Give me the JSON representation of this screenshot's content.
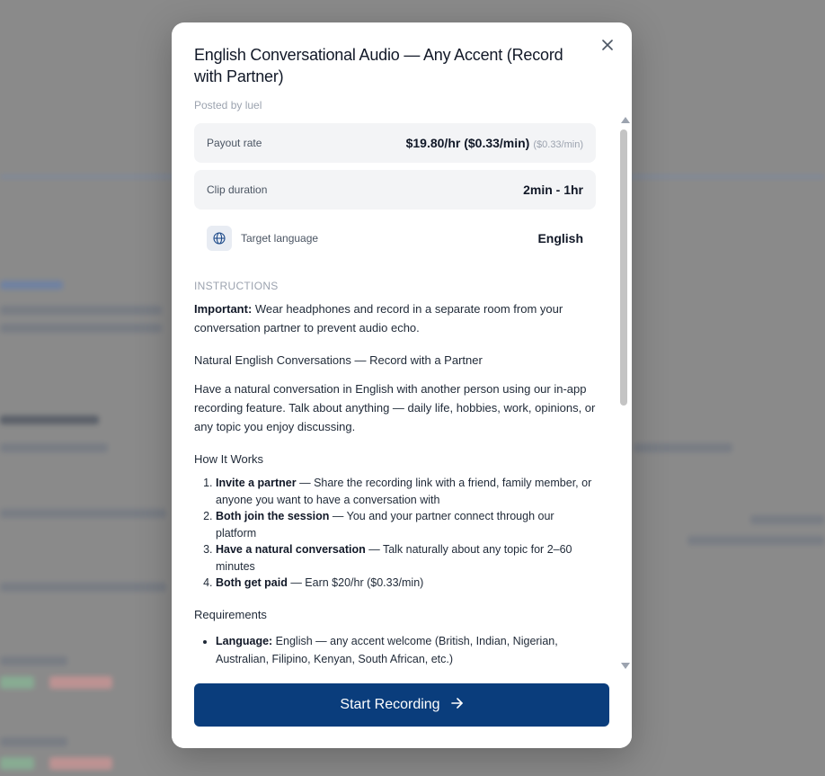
{
  "modal": {
    "title": "English Conversational Audio — Any Accent (Record with Partner)",
    "posted_by": "Posted by luel",
    "payout": {
      "label": "Payout rate",
      "value": "$19.80/hr ($0.33/min)",
      "sub": "($0.33/min)"
    },
    "duration": {
      "label": "Clip duration",
      "value": "2min - 1hr"
    },
    "language": {
      "label": "Target language",
      "value": "English"
    },
    "instructions_heading": "INSTRUCTIONS",
    "important_label": "Important:",
    "important_text": " Wear headphones and record in a separate room from your conversation partner to prevent audio echo.",
    "section1_heading": "Natural English Conversations — Record with a Partner",
    "section1_text": "Have a natural conversation in English with another person using our in-app recording feature. Talk about anything — daily life, hobbies, work, opinions, or any topic you enjoy discussing.",
    "how_heading": "How It Works",
    "steps": [
      {
        "bold": "Invite a partner",
        "text": " — Share the recording link with a friend, family member, or anyone you want to have a conversation with"
      },
      {
        "bold": "Both join the session",
        "text": " — You and your partner connect through our platform"
      },
      {
        "bold": "Have a natural conversation",
        "text": " — Talk naturally about any topic for 2–60 minutes"
      },
      {
        "bold": "Both get paid",
        "text": " — Earn $20/hr ($0.33/min)"
      }
    ],
    "req_heading": "Requirements",
    "requirements": [
      {
        "bold": "Language:",
        "text": " English — any accent welcome (British, Indian, Nigerian, Australian, Filipino, Kenyan, South African, etc.)"
      }
    ],
    "start_button": "Start Recording"
  },
  "icons": {
    "close": "close-icon",
    "globe": "globe-icon",
    "arrow": "arrow-right-icon"
  },
  "colors": {
    "primary": "#0a3d7c",
    "info_bg": "#f3f4f6"
  }
}
